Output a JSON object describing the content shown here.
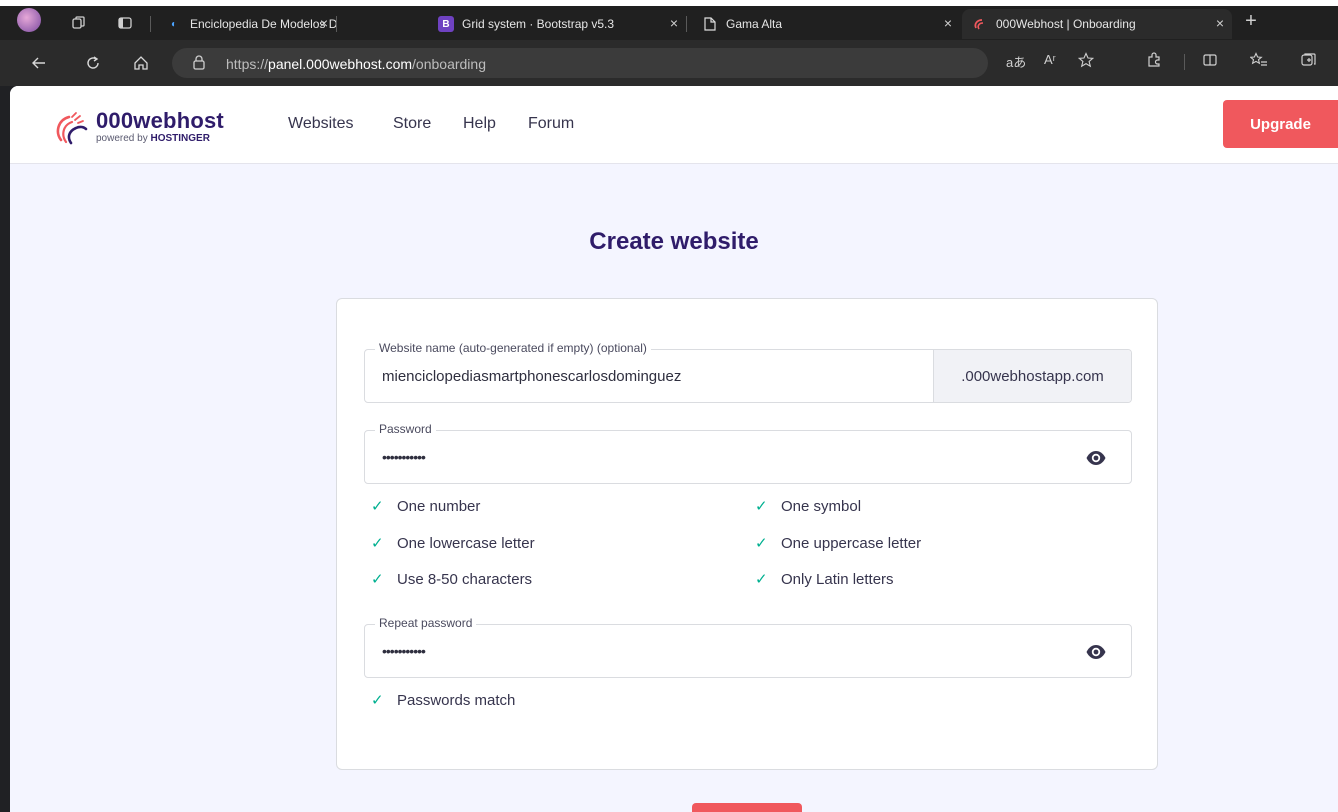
{
  "browser": {
    "tabs": [
      {
        "title": "Enciclopedia De Modelos De Celu",
        "favicon": "app-icon",
        "active": false
      },
      {
        "title": "Grid system · Bootstrap v5.3",
        "favicon": "bootstrap-icon",
        "active": false
      },
      {
        "title": "Gama Alta",
        "favicon": "page-icon",
        "active": false
      },
      {
        "title": "000Webhost | Onboarding",
        "favicon": "000webhost-icon",
        "active": true
      }
    ],
    "new_tab_glyph": "+",
    "close_glyph": "×",
    "url_prefix": "https://",
    "url_host": "panel.000webhost.com",
    "url_path": "/onboarding",
    "read_aloud_label": "Aʳ",
    "translate_label": "aあ"
  },
  "site": {
    "logo": {
      "name": "000webhost",
      "sub_prefix": "powered by ",
      "sub_brand": "HOSTINGER"
    },
    "menu": [
      "Websites",
      "Store",
      "Help",
      "Forum"
    ],
    "upgrade_label": "Upgrade"
  },
  "page": {
    "title": "Create website",
    "website_name": {
      "label": "Website name (auto-generated if empty) (optional)",
      "value": "mienciclopediasmartphonescarlosdominguez",
      "suffix": ".000webhostapp.com"
    },
    "password": {
      "label": "Password",
      "masked_value": "•••••••••••"
    },
    "requirements": [
      {
        "text": "One number",
        "met": true
      },
      {
        "text": "One symbol",
        "met": true
      },
      {
        "text": "One lowercase letter",
        "met": true
      },
      {
        "text": "One uppercase letter",
        "met": true
      },
      {
        "text": "Use 8-50 characters",
        "met": true
      },
      {
        "text": "Only Latin letters",
        "met": true
      }
    ],
    "repeat_password": {
      "label": "Repeat password",
      "masked_value": "•••••••••••"
    },
    "match_text": "Passwords match",
    "check_glyph": "✓"
  },
  "colors": {
    "brand": "#2f1c6a",
    "accent": "#f0585d",
    "success": "#00b090",
    "page_bg": "#f4f5ff"
  }
}
